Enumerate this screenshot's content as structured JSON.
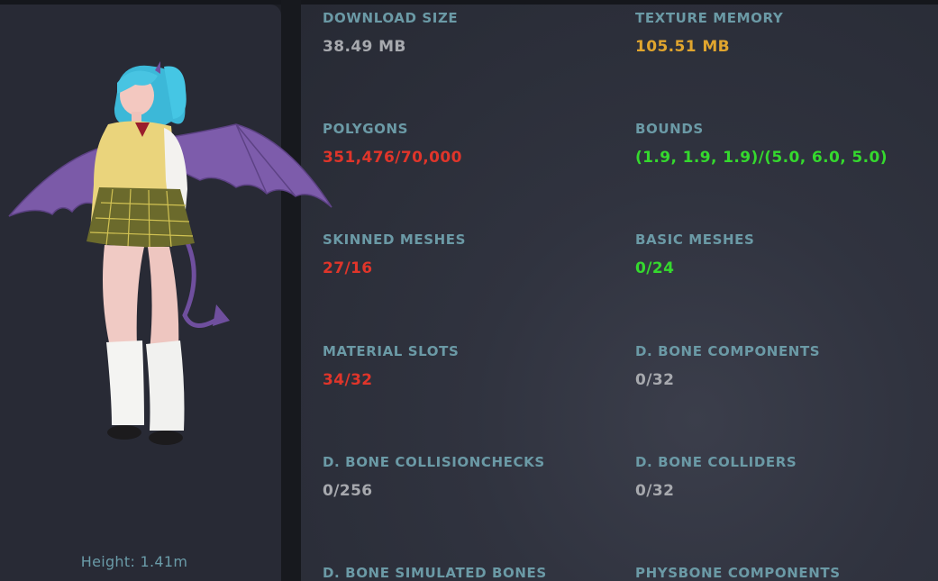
{
  "colors": {
    "label": "#6b9aa6",
    "neutral": "#a7a9ae",
    "warning": "#e0a52e",
    "bad": "#e0352a",
    "good": "#35d92e"
  },
  "preview": {
    "avatar_icon": "avatar-3d-model",
    "height_label": "Height: 1.41m"
  },
  "stats": [
    {
      "id": "download-size",
      "label": "DOWNLOAD SIZE",
      "value": "38.49 MB",
      "status": "neutral"
    },
    {
      "id": "texture-memory",
      "label": "TEXTURE MEMORY",
      "value": "105.51 MB",
      "status": "warning"
    },
    {
      "id": "polygons",
      "label": "POLYGONS",
      "value": "351,476/70,000",
      "status": "bad"
    },
    {
      "id": "bounds",
      "label": "BOUNDS",
      "value": "(1.9, 1.9, 1.9)/(5.0, 6.0, 5.0)",
      "status": "good"
    },
    {
      "id": "skinned-meshes",
      "label": "SKINNED MESHES",
      "value": "27/16",
      "status": "bad"
    },
    {
      "id": "basic-meshes",
      "label": "BASIC MESHES",
      "value": "0/24",
      "status": "good"
    },
    {
      "id": "material-slots",
      "label": "MATERIAL SLOTS",
      "value": "34/32",
      "status": "bad"
    },
    {
      "id": "dbone-components",
      "label": "D. BONE COMPONENTS",
      "value": "0/32",
      "status": "neutral"
    },
    {
      "id": "dbone-collisionchecks",
      "label": "D. BONE COLLISIONCHECKS",
      "value": "0/256",
      "status": "neutral"
    },
    {
      "id": "dbone-colliders",
      "label": "D. BONE COLLIDERS",
      "value": "0/32",
      "status": "neutral"
    },
    {
      "id": "dbone-simulated-bones",
      "label": "D. BONE SIMULATED BONES"
    },
    {
      "id": "physbone-components",
      "label": "PHYSBONE COMPONENTS"
    }
  ]
}
